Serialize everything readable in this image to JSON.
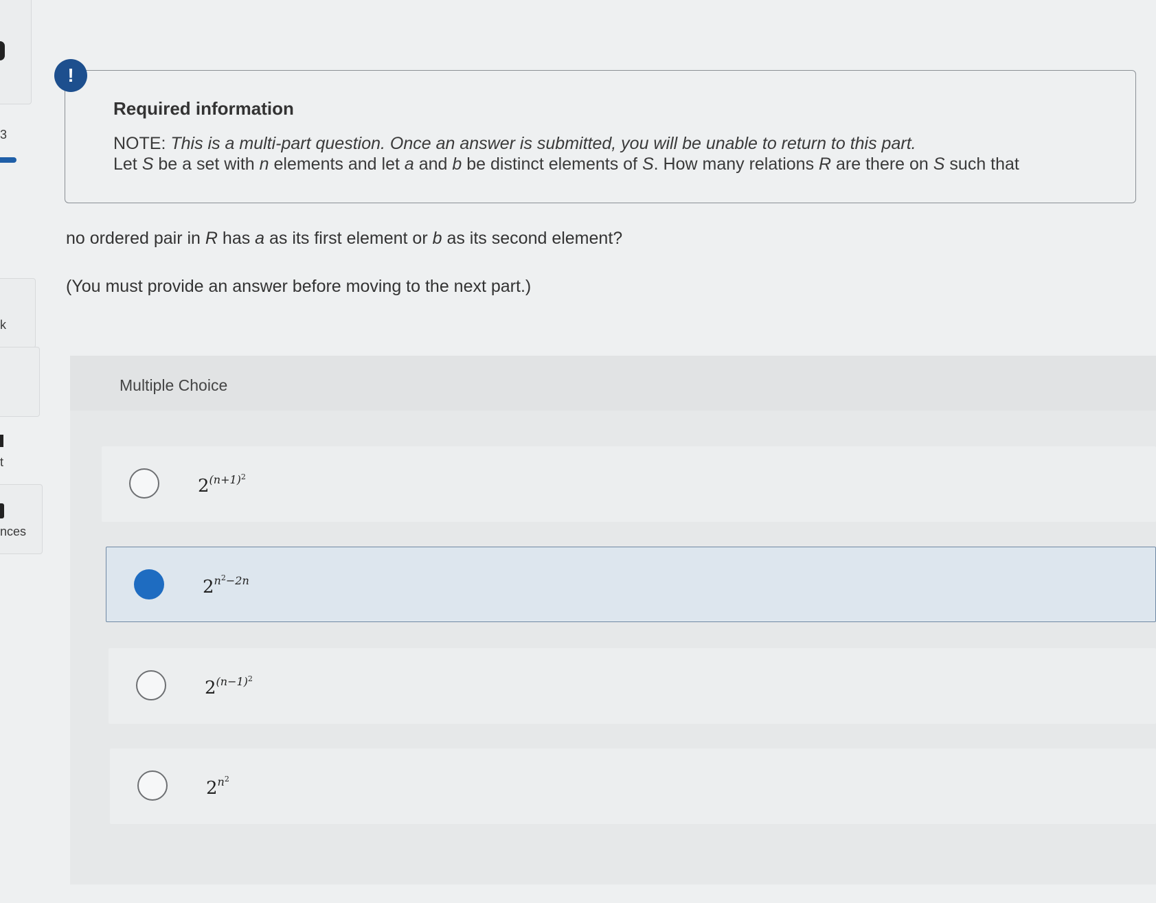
{
  "sidebar": {
    "fragments": [
      "3",
      "k",
      "t",
      "nces"
    ]
  },
  "info": {
    "icon_label": "!",
    "title": "Required information",
    "note_prefix": "NOTE: ",
    "note_text": "This is a multi-part question. Once an answer is submitted, you will be unable to return to this part.",
    "line2_parts": [
      "Let ",
      "S",
      " be a set with ",
      "n",
      " elements and let ",
      "a",
      " and ",
      "b",
      " be distinct elements of ",
      "S",
      ". How many relations ",
      "R",
      " are there on ",
      "S",
      " such that"
    ]
  },
  "question": {
    "line_parts": [
      "no ordered pair in ",
      "R",
      " has ",
      "a",
      " as its first element or ",
      "b",
      " as its second element?"
    ],
    "instruction": "(You must provide an answer before moving to the next part.)"
  },
  "multiple_choice": {
    "title": "Multiple Choice",
    "options": [
      {
        "base": "2",
        "exponent": "(n+1)",
        "exp_power": "2",
        "selected": false
      },
      {
        "base": "2",
        "exponent": "n",
        "exp_power": "2",
        "exp_tail": "−2n",
        "selected": true
      },
      {
        "base": "2",
        "exponent": "(n−1)",
        "exp_power": "2",
        "selected": false
      },
      {
        "base": "2",
        "exponent": "n",
        "exp_power": "2",
        "selected": false
      }
    ]
  },
  "colors": {
    "accent": "#1e6cc1",
    "alert_icon": "#1d4f8e",
    "selected_bg": "#dde6ee"
  }
}
